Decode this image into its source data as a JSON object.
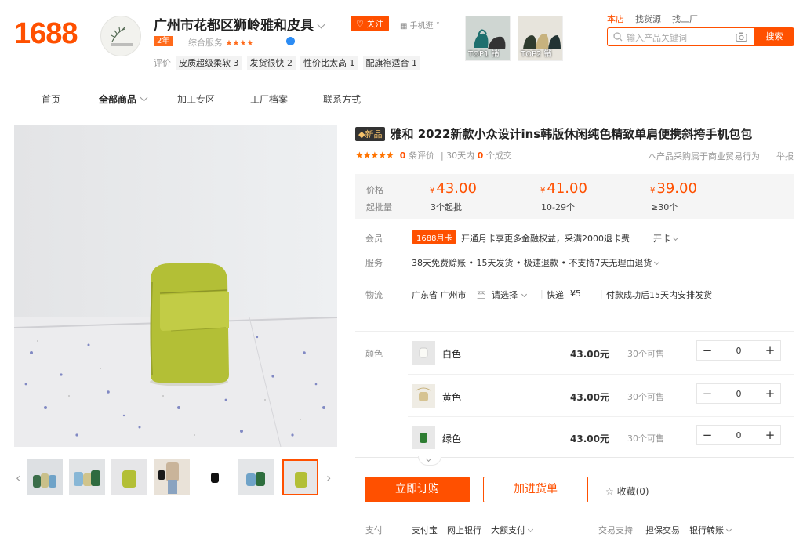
{
  "header": {
    "logo": "1688",
    "shop_name": "广州市花都区狮岭雅和皮具",
    "years_badge": "2年",
    "service_label": "综合服务",
    "service_stars": "★★★★",
    "follow_label": "关注",
    "mobile_label": "手机逛",
    "reviews_label": "评价",
    "review_tags": [
      "皮质超级柔软 3",
      "发货很快 2",
      "性价比太高 1",
      "配旗袍适合 1"
    ],
    "top1_label": "TOP1 销",
    "top2_label": "TOP2 销",
    "search_tabs": [
      "本店",
      "找货源",
      "找工厂"
    ],
    "search_placeholder": "输入产品关键词",
    "search_button": "搜索"
  },
  "nav": {
    "items": [
      "首页",
      "全部商品",
      "加工专区",
      "工厂档案",
      "联系方式"
    ]
  },
  "product": {
    "new_tag": "新品",
    "title": "雅和 2022新款小众设计ins韩版休闲纯色精致单肩便携斜挎手机包包",
    "review_count": "0",
    "review_unit": "条评价",
    "days_label": "30天内",
    "deal_count": "0",
    "deal_unit": "个成交",
    "biz_note": "本产品采购属于商业贸易行为",
    "report": "举报"
  },
  "price": {
    "price_label": "价格",
    "moq_label": "起批量",
    "tiers": [
      {
        "price": "43.00",
        "qty": "3个起批"
      },
      {
        "price": "41.00",
        "qty": "10-29个"
      },
      {
        "price": "39.00",
        "qty": "≥30个"
      }
    ],
    "currency": "¥"
  },
  "member": {
    "label": "会员",
    "card": "1688月卡",
    "text": "开通月卡享更多金融权益，采满2000退卡费",
    "link": "开卡"
  },
  "service": {
    "label": "服务",
    "text": "38天免费赊账 • 15天发货 • 极速退款 • 不支持7天无理由退货"
  },
  "logistics": {
    "label": "物流",
    "from": "广东省 广州市",
    "to_label": "至",
    "select": "请选择",
    "express": "快递",
    "fee": "¥5",
    "ship_note": "付款成功后15天内安排发货"
  },
  "sku": {
    "label": "颜色",
    "items": [
      {
        "name": "白色",
        "price": "43.00元",
        "avail": "30个可售",
        "qty": "0",
        "color": "#eeeeea"
      },
      {
        "name": "黄色",
        "price": "43.00元",
        "avail": "30个可售",
        "qty": "0",
        "color": "#d8c79a"
      },
      {
        "name": "绿色",
        "price": "43.00元",
        "avail": "30个可售",
        "qty": "0",
        "color": "#2e7d32"
      }
    ],
    "minus": "−",
    "plus": "+"
  },
  "actions": {
    "buy": "立即订购",
    "cart": "加进货单",
    "favorite": "收藏(0)"
  },
  "payment": {
    "label": "支付",
    "methods": [
      "支付宝",
      "网上银行",
      "大额支付"
    ],
    "trade_label": "交易支持",
    "trade_methods": [
      "担保交易",
      "银行转账"
    ]
  },
  "colors": {
    "accent": "#ff5000",
    "bag": "#b6c23a"
  }
}
